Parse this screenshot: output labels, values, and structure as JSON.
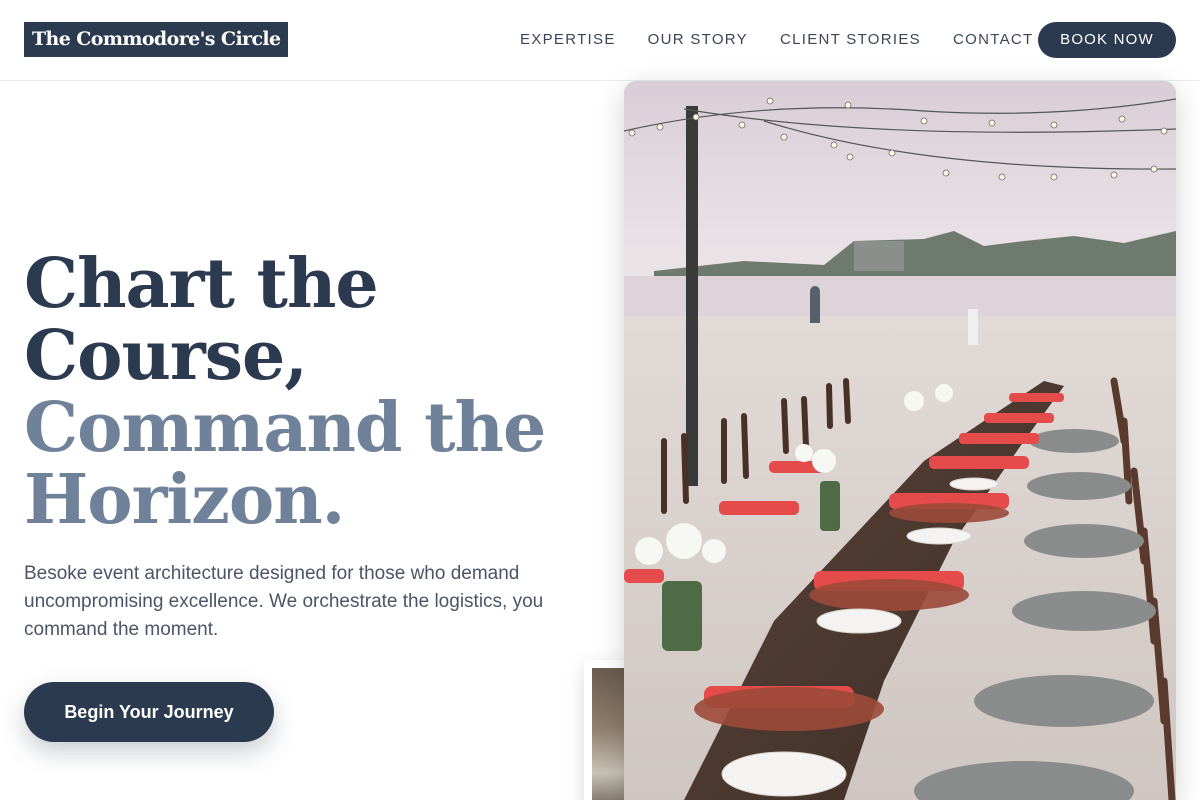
{
  "header": {
    "logo": "The Commodore's Circle",
    "nav": [
      "EXPERTISE",
      "OUR STORY",
      "CLIENT STORIES",
      "CONTACT"
    ],
    "book_label": "BOOK NOW"
  },
  "hero": {
    "headline_lines": [
      "Chart the",
      "Course,",
      "Command the",
      "Horizon."
    ],
    "description": "Besoke event architecture designed for those who demand uncompromising excellence. We orchestrate the logistics, you command the moment.",
    "cta_label": "Begin Your Journey"
  },
  "colors": {
    "primary": "#2b3a4f",
    "secondary": "#6f8299",
    "napkin": "#e64b4b"
  },
  "images": {
    "main_photo": "beach-dinner-table-photo",
    "secondary_photo": "interior-venue-photo"
  }
}
